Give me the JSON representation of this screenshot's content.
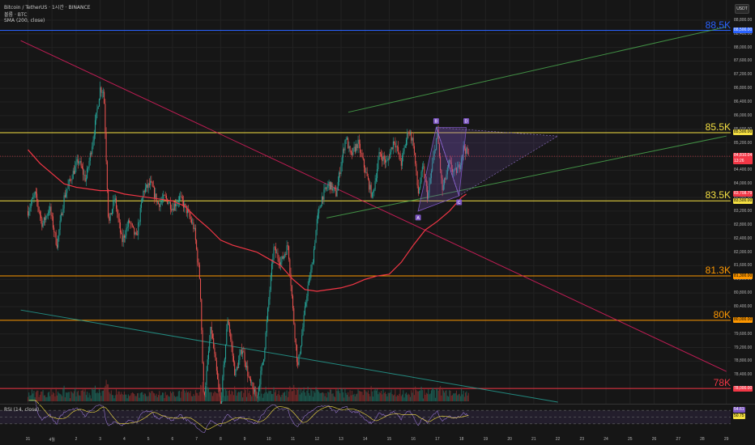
{
  "header": {
    "title": "Bitcoin / TetherUS · 1시간 · BINANCE",
    "volume": "볼륨 · BTC",
    "sma": "SMA (200, close)"
  },
  "currency": "USDT",
  "price_axis": [
    "88,800.00",
    "88,400.00",
    "88,000.00",
    "87,600.00",
    "87,200.00",
    "86,800.00",
    "86,400.00",
    "86,000.00",
    "85,600.00",
    "85,200.00",
    "84,800.00",
    "84,400.00",
    "84,000.00",
    "83,600.00",
    "83,200.00",
    "82,800.00",
    "82,400.00",
    "82,000.00",
    "81,600.00",
    "81,200.00",
    "80,800.00",
    "80,400.00",
    "80,000.00",
    "79,600.00",
    "79,200.00",
    "78,800.00",
    "78,400.00",
    "78,000.00"
  ],
  "time_axis": [
    "31",
    "4월",
    "2",
    "3",
    "4",
    "5",
    "6",
    "7",
    "8",
    "9",
    "10",
    "11",
    "12",
    "13",
    "14",
    "15",
    "16",
    "17",
    "18",
    "19",
    "20",
    "21",
    "22",
    "23",
    "24",
    "25",
    "26",
    "27",
    "28",
    "29"
  ],
  "levels": [
    {
      "label": "88.5K",
      "price": 88500,
      "color": "#2962ff",
      "tag": "88,500.00"
    },
    {
      "label": "85.5K",
      "price": 85500,
      "color": "#f5e042",
      "tag": "85,500.00"
    },
    {
      "label": "83.5K",
      "price": 83500,
      "color": "#f5e042",
      "tag": "83,500.00"
    },
    {
      "label": "81.3K",
      "price": 81300,
      "color": "#ff9800",
      "tag": "81,300.00"
    },
    {
      "label": "80K",
      "price": 80000,
      "color": "#ff9800",
      "tag": "80,000.00"
    },
    {
      "label": "78K",
      "price": 78000,
      "color": "#f23645",
      "tag": "78,000.00"
    }
  ],
  "current_price": {
    "value": "84,810.04",
    "countdown": "13:26",
    "color": "#f23645"
  },
  "sma_tag": {
    "value": "83,708.79",
    "color": "#f23645"
  },
  "pattern_points": [
    {
      "label": "A",
      "day": 16.2,
      "price": 83200
    },
    {
      "label": "B",
      "day": 16.95,
      "price": 85650
    },
    {
      "label": "C",
      "day": 17.9,
      "price": 83650
    },
    {
      "label": "D",
      "day": 18.2,
      "price": 85650
    }
  ],
  "rsi": {
    "label": "RSI (14, close)",
    "value": "54.61",
    "ma": "50.75"
  },
  "chart_data": {
    "type": "candlestick",
    "symbol": "Bitcoin / TetherUS",
    "interval": "1시간",
    "exchange": "BINANCE",
    "x_unit": "day (March 31 = 0; April dates as printed)",
    "ylim": [
      77600,
      89200
    ],
    "horizontal_levels": [
      88500,
      85500,
      83500,
      81300,
      80000,
      78000
    ],
    "price_path": [
      [
        0.0,
        83200
      ],
      [
        0.3,
        83700
      ],
      [
        0.6,
        82800
      ],
      [
        0.9,
        83300
      ],
      [
        1.2,
        82200
      ],
      [
        1.5,
        83600
      ],
      [
        1.8,
        84200
      ],
      [
        2.1,
        84700
      ],
      [
        2.4,
        84100
      ],
      [
        2.7,
        85300
      ],
      [
        3.0,
        86800
      ],
      [
        3.15,
        86700
      ],
      [
        3.35,
        82800
      ],
      [
        3.6,
        83600
      ],
      [
        3.9,
        82300
      ],
      [
        4.2,
        82900
      ],
      [
        4.5,
        82400
      ],
      [
        4.8,
        83800
      ],
      [
        5.1,
        84000
      ],
      [
        5.4,
        83400
      ],
      [
        5.7,
        83600
      ],
      [
        6.0,
        83300
      ],
      [
        6.3,
        83600
      ],
      [
        6.6,
        83200
      ],
      [
        6.9,
        82700
      ],
      [
        7.15,
        81100
      ],
      [
        7.3,
        77600
      ],
      [
        7.6,
        79800
      ],
      [
        8.0,
        77500
      ],
      [
        8.3,
        80100
      ],
      [
        8.6,
        78400
      ],
      [
        8.9,
        79200
      ],
      [
        9.2,
        78200
      ],
      [
        9.5,
        77700
      ],
      [
        9.8,
        79000
      ],
      [
        10.0,
        80600
      ],
      [
        10.2,
        82100
      ],
      [
        10.5,
        81700
      ],
      [
        10.8,
        82200
      ],
      [
        11.0,
        80300
      ],
      [
        11.2,
        78600
      ],
      [
        11.4,
        79700
      ],
      [
        11.6,
        80900
      ],
      [
        11.8,
        81600
      ],
      [
        12.0,
        82900
      ],
      [
        12.2,
        83600
      ],
      [
        12.5,
        84000
      ],
      [
        12.8,
        83700
      ],
      [
        13.0,
        84600
      ],
      [
        13.2,
        85400
      ],
      [
        13.4,
        84800
      ],
      [
        13.7,
        85200
      ],
      [
        14.0,
        84400
      ],
      [
        14.3,
        83600
      ],
      [
        14.6,
        84900
      ],
      [
        14.9,
        84600
      ],
      [
        15.2,
        85300
      ],
      [
        15.5,
        84600
      ],
      [
        15.8,
        85600
      ],
      [
        16.0,
        85200
      ],
      [
        16.2,
        83700
      ],
      [
        16.4,
        84500
      ],
      [
        16.6,
        83600
      ],
      [
        16.8,
        84600
      ],
      [
        17.0,
        85500
      ],
      [
        17.2,
        83800
      ],
      [
        17.5,
        84600
      ],
      [
        17.7,
        84300
      ],
      [
        17.9,
        84500
      ],
      [
        18.1,
        85100
      ],
      [
        18.3,
        84800
      ]
    ],
    "sma200": [
      [
        0.0,
        85000
      ],
      [
        0.5,
        84600
      ],
      [
        1.0,
        84300
      ],
      [
        1.5,
        84000
      ],
      [
        2.0,
        83900
      ],
      [
        2.5,
        83850
      ],
      [
        3.0,
        83800
      ],
      [
        3.5,
        83800
      ],
      [
        4.0,
        83700
      ],
      [
        4.5,
        83650
      ],
      [
        5.0,
        83600
      ],
      [
        5.5,
        83550
      ],
      [
        6.0,
        83500
      ],
      [
        6.5,
        83350
      ],
      [
        7.0,
        83000
      ],
      [
        7.5,
        82700
      ],
      [
        8.0,
        82350
      ],
      [
        8.5,
        82200
      ],
      [
        9.0,
        82100
      ],
      [
        9.5,
        82000
      ],
      [
        10.0,
        81800
      ],
      [
        10.5,
        81600
      ],
      [
        11.0,
        81200
      ],
      [
        11.5,
        80900
      ],
      [
        12.0,
        80850
      ],
      [
        12.5,
        80900
      ],
      [
        13.0,
        80950
      ],
      [
        13.5,
        81050
      ],
      [
        14.0,
        81200
      ],
      [
        14.5,
        81300
      ],
      [
        15.0,
        81350
      ],
      [
        15.5,
        81700
      ],
      [
        16.0,
        82200
      ],
      [
        16.5,
        82650
      ],
      [
        17.0,
        82900
      ],
      [
        17.5,
        83200
      ],
      [
        18.0,
        83600
      ],
      [
        18.2,
        83700
      ]
    ],
    "trendlines": [
      {
        "name": "pink-descending",
        "color": "#e91e63",
        "points": [
          [
            -0.3,
            88200
          ],
          [
            29,
            78500
          ]
        ]
      },
      {
        "name": "cyan-descending",
        "color": "#26a69a",
        "points": [
          [
            -0.3,
            80300
          ],
          [
            22,
            77600
          ]
        ]
      },
      {
        "name": "green-upper-channel",
        "color": "#4caf50",
        "points": [
          [
            13.3,
            86100
          ],
          [
            29,
            88600
          ]
        ]
      },
      {
        "name": "green-lower-channel",
        "color": "#4caf50",
        "points": [
          [
            12.4,
            83000
          ],
          [
            29,
            85400
          ]
        ]
      }
    ],
    "rsi_period": 14,
    "rsi_levels": [
      70,
      50,
      30
    ]
  }
}
